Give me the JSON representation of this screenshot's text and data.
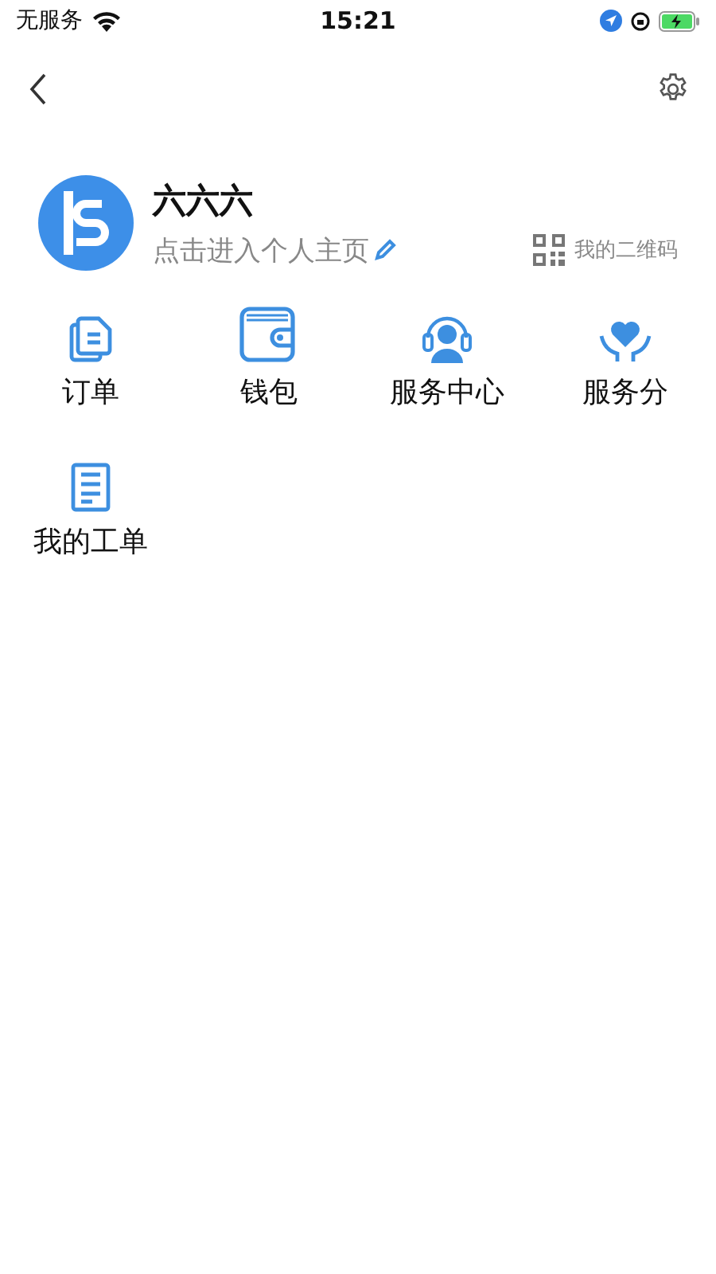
{
  "status_bar": {
    "carrier": "无服务",
    "time": "15:21"
  },
  "profile": {
    "name": "六六六",
    "link": "点击进入个人主页",
    "qr_label": "我的二维码"
  },
  "menu": [
    {
      "kind": "document",
      "label": "订单"
    },
    {
      "kind": "wallet",
      "label": "钱包"
    },
    {
      "kind": "headset",
      "label": "服务中心"
    },
    {
      "kind": "heart",
      "label": "服务分"
    },
    {
      "kind": "clipboard",
      "label": "我的工单"
    }
  ]
}
